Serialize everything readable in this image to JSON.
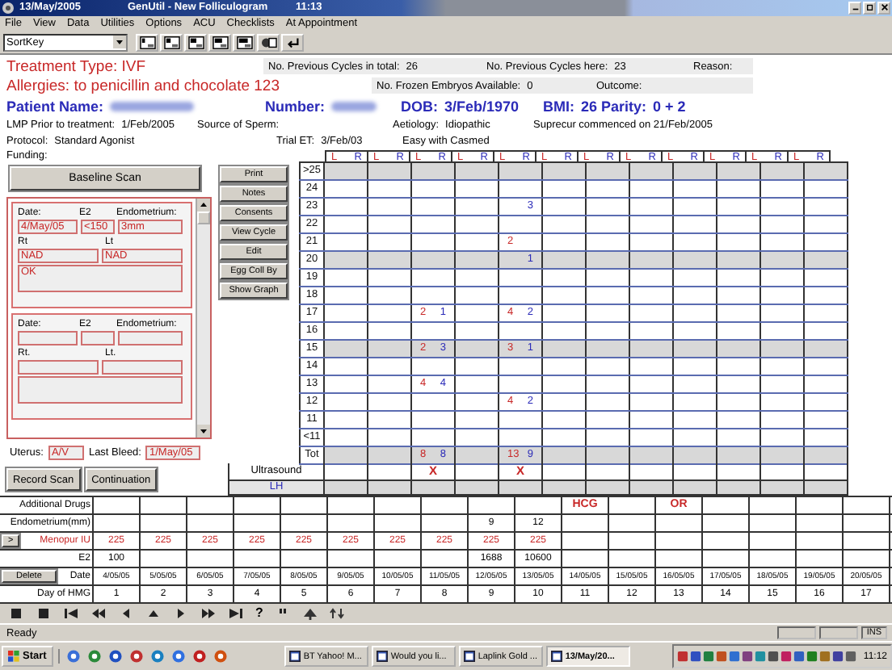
{
  "title_bar": {
    "date": "13/May/2005",
    "title": "GenUtil - New Folliculogram",
    "time": "11:13"
  },
  "menu": [
    "File",
    "View",
    "Data",
    "Utilities",
    "Options",
    "ACU",
    "Checklists",
    "At Appointment"
  ],
  "toolbar": {
    "sort_select": "SortKey"
  },
  "treatment_type": {
    "label": "Treatment Type:",
    "value": "IVF"
  },
  "allergies": {
    "label": "Allergies:",
    "value": "to penicillin and chocolate 123"
  },
  "cycle_info": [
    {
      "label": "No. Previous Cycles in total:",
      "value": "26"
    },
    {
      "label": "No. Previous Cycles here:",
      "value": "23"
    },
    {
      "label": "Reason:"
    }
  ],
  "embryo_info": [
    {
      "label": "No. Frozen Embryos Available:",
      "value": "0"
    },
    {
      "label": "Outcome:"
    }
  ],
  "patient": [
    {
      "label": "Patient Name:",
      "redacted": true
    },
    {
      "label": "Number:",
      "redacted": true
    },
    {
      "label": "DOB:",
      "value": "3/Feb/1970",
      "redacted": false
    },
    {
      "label": "BMI:",
      "value": "26",
      "redacted": false
    },
    {
      "label": "Parity:",
      "value": "0  +  2",
      "redacted": false
    }
  ],
  "details_1": [
    {
      "label": "LMP Prior to treatment:",
      "value": "1/Feb/2005"
    },
    {
      "label": "Source of Sperm:"
    },
    {
      "label": "Aetiology:",
      "value": "Idiopathic"
    },
    {
      "label": "Suprecur commenced on 21/Feb/2005"
    }
  ],
  "details_2": [
    {
      "label": "Protocol:",
      "value": "Standard Agonist"
    },
    {
      "label": "Trial ET:",
      "value": "3/Feb/03"
    },
    {
      "label": "Easy with Casmed"
    }
  ],
  "funding": "Funding:",
  "scan_panel": {
    "button": "Baseline Scan",
    "scans": [
      {
        "date_label": "Date:",
        "e2_label": "E2",
        "endo_label": "Endometrium:",
        "rt_label": "Rt",
        "lt_label": "Lt",
        "date": "4/May/05",
        "e2": "<150",
        "endometrium": "3mm",
        "rt": "NAD",
        "lt": "NAD",
        "comment": "OK"
      },
      {
        "date_label": "Date:",
        "e2_label": "E2",
        "endo_label": "Endometrium:",
        "rt_label": "Rt.",
        "lt_label": "Lt."
      }
    ]
  },
  "uterus": {
    "label": "Uterus:",
    "value": "A/V"
  },
  "last_bleed": {
    "label": "Last Bleed:",
    "value": "1/May/05"
  },
  "side_buttons": [
    "Print",
    "Notes",
    "Consents",
    "View Cycle",
    "Edit",
    "Egg Coll By",
    "Show Graph"
  ],
  "follicle_grid": {
    "columns": [
      {
        "left": "L",
        "right": "R"
      },
      {
        "left": "L",
        "right": "R"
      },
      {
        "left": "L",
        "right": "R"
      },
      {
        "left": "L",
        "right": "R"
      },
      {
        "left": "L",
        "right": "R"
      },
      {
        "left": "L",
        "right": "R"
      },
      {
        "left": "L",
        "right": "R"
      },
      {
        "left": "L",
        "right": "R"
      },
      {
        "left": "L",
        "right": "R"
      },
      {
        "left": "L",
        "right": "R"
      },
      {
        "left": "L",
        "right": "R"
      },
      {
        "left": "L",
        "right": "R"
      }
    ],
    "rows": [
      {
        "label": ">25",
        "shaded": true,
        "cells": [
          null,
          null,
          null,
          null,
          null,
          null,
          null,
          null,
          null,
          null,
          null,
          null
        ]
      },
      {
        "label": "24",
        "shaded": false,
        "cells": [
          null,
          null,
          null,
          null,
          null,
          null,
          null,
          null,
          null,
          null,
          null,
          null
        ]
      },
      {
        "label": "23",
        "shaded": false,
        "cells": [
          null,
          null,
          null,
          null,
          {
            "r": "3"
          },
          null,
          null,
          null,
          null,
          null,
          null,
          null
        ]
      },
      {
        "label": "22",
        "shaded": false,
        "cells": [
          null,
          null,
          null,
          null,
          null,
          null,
          null,
          null,
          null,
          null,
          null,
          null
        ]
      },
      {
        "label": "21",
        "shaded": false,
        "cells": [
          null,
          null,
          null,
          null,
          {
            "l": "2"
          },
          null,
          null,
          null,
          null,
          null,
          null,
          null
        ]
      },
      {
        "label": "20",
        "shaded": true,
        "cells": [
          null,
          null,
          null,
          null,
          {
            "r": "1"
          },
          null,
          null,
          null,
          null,
          null,
          null,
          null
        ]
      },
      {
        "label": "19",
        "shaded": false,
        "cells": [
          null,
          null,
          null,
          null,
          null,
          null,
          null,
          null,
          null,
          null,
          null,
          null
        ]
      },
      {
        "label": "18",
        "shaded": false,
        "cells": [
          null,
          null,
          null,
          null,
          null,
          null,
          null,
          null,
          null,
          null,
          null,
          null
        ]
      },
      {
        "label": "17",
        "shaded": false,
        "cells": [
          null,
          null,
          {
            "l": "2",
            "r": "1"
          },
          null,
          {
            "l": "4",
            "r": "2"
          },
          null,
          null,
          null,
          null,
          null,
          null,
          null
        ]
      },
      {
        "label": "16",
        "shaded": false,
        "cells": [
          null,
          null,
          null,
          null,
          null,
          null,
          null,
          null,
          null,
          null,
          null,
          null
        ]
      },
      {
        "label": "15",
        "shaded": true,
        "cells": [
          null,
          null,
          {
            "l": "2",
            "r": "3"
          },
          null,
          {
            "l": "3",
            "r": "1"
          },
          null,
          null,
          null,
          null,
          null,
          null,
          null
        ]
      },
      {
        "label": "14",
        "shaded": false,
        "cells": [
          null,
          null,
          null,
          null,
          null,
          null,
          null,
          null,
          null,
          null,
          null,
          null
        ]
      },
      {
        "label": "13",
        "shaded": false,
        "cells": [
          null,
          null,
          {
            "l": "4",
            "r": "4"
          },
          null,
          null,
          null,
          null,
          null,
          null,
          null,
          null,
          null
        ]
      },
      {
        "label": "12",
        "shaded": false,
        "cells": [
          null,
          null,
          null,
          null,
          {
            "l": "4",
            "r": "2"
          },
          null,
          null,
          null,
          null,
          null,
          null,
          null
        ]
      },
      {
        "label": "11",
        "shaded": false,
        "cells": [
          null,
          null,
          null,
          null,
          null,
          null,
          null,
          null,
          null,
          null,
          null,
          null
        ]
      },
      {
        "label": "<11",
        "shaded": false,
        "cells": [
          null,
          null,
          null,
          null,
          null,
          null,
          null,
          null,
          null,
          null,
          null,
          null
        ]
      },
      {
        "label": "Tot",
        "shaded": true,
        "cells": [
          null,
          null,
          {
            "l": "8",
            "r": "8"
          },
          null,
          {
            "l": "13",
            "r": "9"
          },
          null,
          null,
          null,
          null,
          null,
          null,
          null
        ]
      }
    ]
  },
  "scan_buttons": [
    "Record Scan",
    "Continuation"
  ],
  "ultrasound": {
    "label": "Ultrasound",
    "cells": [
      null,
      null,
      "X",
      null,
      "X",
      null,
      null,
      null,
      null,
      null,
      null,
      null
    ]
  },
  "lh": {
    "label": "LH"
  },
  "drug_table": {
    "rows": [
      {
        "label": "Additional Drugs",
        "kind": "drug",
        "cells": [
          null,
          null,
          null,
          null,
          null,
          null,
          null,
          null,
          null,
          null,
          "HCG",
          null,
          "OR",
          null,
          null,
          null,
          null
        ]
      },
      {
        "label": "Endometrium(mm)",
        "kind": "plain",
        "cells": [
          null,
          null,
          null,
          null,
          null,
          null,
          null,
          null,
          "9",
          "12",
          null,
          null,
          null,
          null,
          null,
          null,
          null
        ]
      },
      {
        "label": "Menopur IU",
        "kind": "dose",
        "button": ">",
        "cells": [
          "225",
          "225",
          "225",
          "225",
          "225",
          "225",
          "225",
          "225",
          "225",
          "225",
          null,
          null,
          null,
          null,
          null,
          null,
          null
        ]
      },
      {
        "label": "E2",
        "kind": "plain",
        "cells": [
          "100",
          null,
          null,
          null,
          null,
          null,
          null,
          null,
          "1688",
          "10600",
          null,
          null,
          null,
          null,
          null,
          null,
          null
        ]
      },
      {
        "label": "Date",
        "kind": "date",
        "button": "Delete",
        "cells": [
          "4/05/05",
          "5/05/05",
          "6/05/05",
          "7/05/05",
          "8/05/05",
          "9/05/05",
          "10/05/05",
          "11/05/05",
          "12/05/05",
          "13/05/05",
          "14/05/05",
          "15/05/05",
          "16/05/05",
          "17/05/05",
          "18/05/05",
          "19/05/05",
          "20/05/05"
        ]
      },
      {
        "label": "Day of HMG",
        "kind": "plain",
        "cells": [
          "1",
          "2",
          "3",
          "4",
          "5",
          "6",
          "7",
          "8",
          "9",
          "10",
          "11",
          "12",
          "13",
          "14",
          "15",
          "16",
          "17"
        ]
      }
    ]
  },
  "help_button": "?",
  "status_bar": {
    "text": "Ready",
    "mode": "INS"
  },
  "taskbar": {
    "start": "Start",
    "tasks": [
      {
        "label": "BT Yahoo! M...",
        "selected": false
      },
      {
        "label": "Would you li...",
        "selected": false
      },
      {
        "label": "Laplink Gold ...",
        "selected": false
      },
      {
        "label": "13/May/20...",
        "selected": true
      }
    ],
    "clock": "11:12"
  }
}
